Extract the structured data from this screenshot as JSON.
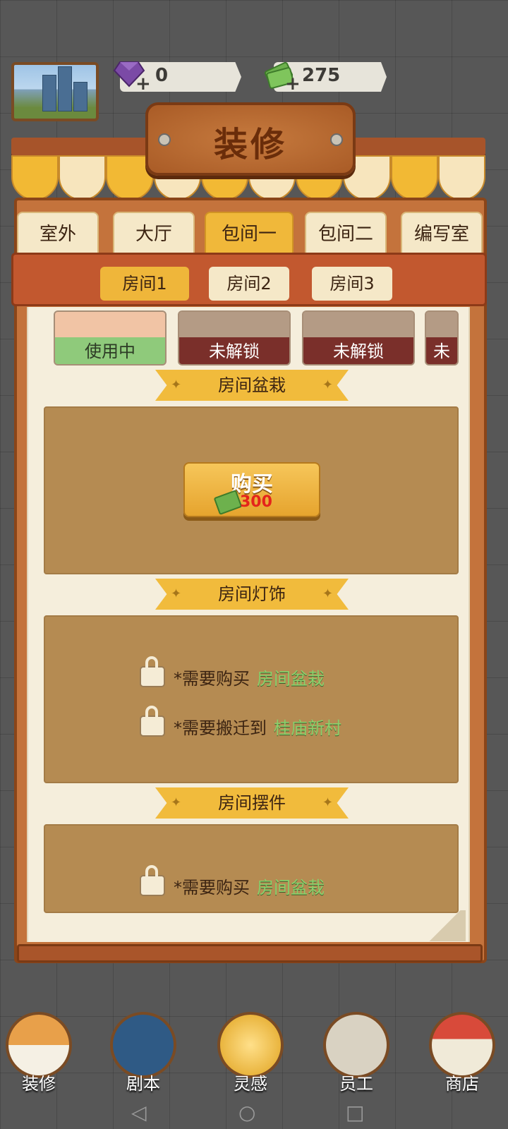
{
  "hud": {
    "gems": "0",
    "cash": "275",
    "plus": "+"
  },
  "sign": {
    "title": "装修"
  },
  "tabs": [
    {
      "label": "室外",
      "active": false
    },
    {
      "label": "大厅",
      "active": false
    },
    {
      "label": "包间一",
      "active": true
    },
    {
      "label": "包间二",
      "active": false
    },
    {
      "label": "编写室",
      "active": false
    }
  ],
  "rooms": [
    {
      "label": "房间1",
      "active": true
    },
    {
      "label": "房间2",
      "active": false
    },
    {
      "label": "房间3",
      "active": false
    }
  ],
  "cards": [
    {
      "label": "使用中"
    },
    {
      "label": "未解锁"
    },
    {
      "label": "未解锁"
    },
    {
      "label": "未"
    }
  ],
  "sections": {
    "plant": {
      "title": "房间盆栽",
      "buy_label": "购买",
      "price": "300"
    },
    "light": {
      "title": "房间灯饰",
      "req1_text": "*需要购买",
      "req1_link": "房间盆栽",
      "req2_text": "*需要搬迁到",
      "req2_link": "桂庙新村"
    },
    "decor": {
      "title": "房间摆件",
      "req1_text": "*需要购买",
      "req1_link": "房间盆栽"
    }
  },
  "nav": [
    {
      "label": "装修"
    },
    {
      "label": "剧本"
    },
    {
      "label": "灵感"
    },
    {
      "label": "员工"
    },
    {
      "label": "商店"
    }
  ],
  "icons": {
    "gem": "gem-icon",
    "cash": "cash-icon",
    "lock": "lock-icon",
    "star": "✦"
  },
  "colors": {
    "accent": "#f0b83a",
    "panel": "#c4733c",
    "section_bg": "#b58b52",
    "price": "#e4241b",
    "link": "#8bd06c"
  }
}
